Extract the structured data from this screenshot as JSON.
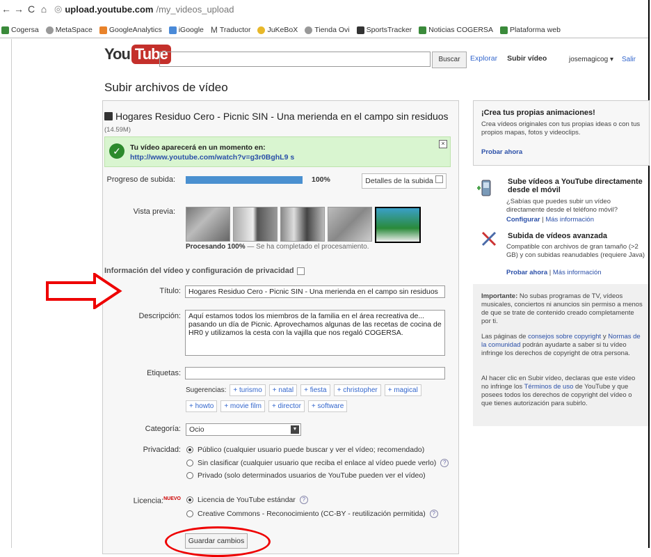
{
  "browser": {
    "url_host": "upload.youtube.com",
    "url_path": "/my_videos_upload",
    "bookmarks": [
      "Cogersa",
      "MetaSpace",
      "GoogleAnalytics",
      "iGoogle",
      "Traductor",
      "JuKeBoX",
      "Tienda Ovi",
      "SportsTracker",
      "Noticias COGERSA",
      "Plataforma web"
    ]
  },
  "header": {
    "logo_you": "You",
    "logo_tube": "Tube",
    "search_button": "Buscar",
    "nav": [
      "Explorar",
      "Subir vídeo"
    ],
    "username": "josemagicog",
    "user_link": "Salir"
  },
  "page": {
    "title": "Subir archivos de vídeo"
  },
  "upload": {
    "file_name": "Hogares Residuo Cero - Picnic SIN - Una merienda en el campo sin residuos",
    "file_size": "(14.59M)",
    "notice_title": "Tu vídeo aparecerá en un momento en:",
    "notice_url": "http://www.youtube.com/watch?v=g3r0BghL9 s",
    "progress_label": "Progreso de subida:",
    "progress_fraction": 1.0,
    "progress_text": "100%",
    "details_button": "Detalles de la subida",
    "preview_label": "Vista previa:",
    "processing_bold": "Procesando 100%",
    "processing_rest": "— Se ha completado el procesamiento."
  },
  "form": {
    "section_title": "Información del vídeo y configuración de privacidad",
    "title_label": "Título:",
    "title_value": "Hogares Residuo Cero - Picnic SIN - Una merienda en el campo sin residuos",
    "desc_label": "Descripción:",
    "desc_value": "Aquí estamos todos los miembros de la familia en el área recreativa de...\npasando un día de Picnic. Aprovechamos algunas de las recetas de cocina de HR0 y utilizamos la cesta con la vajilla que nos regaló COGERSA.",
    "tags_label": "Etiquetas:",
    "suggest_label": "Sugerencias:",
    "suggestions": [
      "+ turismo",
      "+ natal",
      "+ fiesta",
      "+ christopher",
      "+ magical",
      "+ howto",
      "+ movie film",
      "+ director",
      "+ software"
    ],
    "category_label": "Categoría:",
    "category_value": "Ocio",
    "privacy_label": "Privacidad:",
    "privacy_options": [
      "Público (cualquier usuario puede buscar y ver el vídeo; recomendado)",
      "Sin clasificar (cualquier usuario que reciba el enlace al vídeo puede verlo)",
      "Privado (solo determinados usuarios de YouTube pueden ver el vídeo)"
    ],
    "license_label": "Licencia:",
    "license_new": "NUEVO",
    "license_options": [
      "Licencia de YouTube estándar",
      "Creative Commons - Reconocimiento (CC-BY - reutilización permitida)"
    ],
    "save_button": "Guardar cambios"
  },
  "sidebar": {
    "promo_title": "¡Crea tus propias animaciones!",
    "promo_text": "Crea vídeos originales con tus propias ideas o con tus propios mapas, fotos y videoclips.",
    "promo_link": "Probar ahora",
    "mobile_title": "Sube vídeos a YouTube directamente desde el móvil",
    "mobile_text": "¿Sabías que puedes subir un vídeo directamente desde el teléfono móvil?",
    "mobile_link1": "Configurar",
    "mobile_link2": "Más información",
    "adv_title": "Subida de vídeos avanzada",
    "adv_text": "Compatible con archivos de gran tamaño (>2 GB) y con subidas reanudables (requiere Java)",
    "adv_link1": "Probar ahora",
    "adv_link2": "Más información",
    "imp_bold": "Importante:",
    "imp_text": "No subas programas de TV, vídeos musicales, conciertos ni anuncios sin permiso a menos de que se trate de contenido creado completamente por ti.",
    "p2_a": "Las páginas de",
    "p2_link1": "consejos sobre copyright",
    "p2_b": "y",
    "p2_link2": "Normas de la comunidad",
    "p2_c": "podrán ayudarte a saber si tu vídeo infringe los derechos de copyright de otra persona.",
    "p3_a": "Al hacer clic en Subir vídeo, declaras que este vídeo no infringe los",
    "p3_link": "Términos de uso",
    "p3_b": "de YouTube y que posees todos los derechos de copyright del vídeo o que tienes autorización para subirlo."
  }
}
